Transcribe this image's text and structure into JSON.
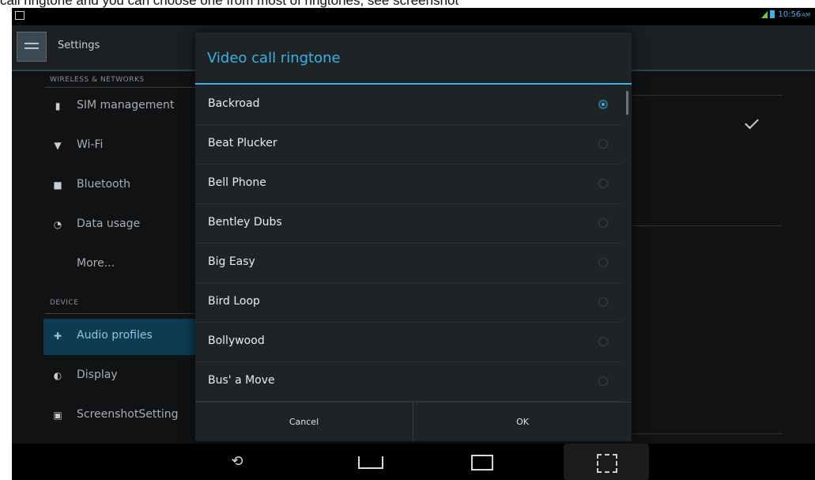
{
  "caption": {
    "text": "call ringtone and you can choose one from most of ringtones, see screenshot"
  },
  "status_bar": {
    "time": "10:56",
    "ampm": "AM"
  },
  "action_bar": {
    "title": "Settings"
  },
  "settings_list": {
    "sections": [
      {
        "header": "WIRELESS & NETWORKS",
        "items": [
          {
            "label": "SIM management",
            "icon": "sim-icon"
          },
          {
            "label": "Wi-Fi",
            "icon": "wifi-icon"
          },
          {
            "label": "Bluetooth",
            "icon": "bluetooth-icon"
          },
          {
            "label": "Data usage",
            "icon": "data-usage-icon"
          },
          {
            "label": "More...",
            "icon": ""
          }
        ]
      },
      {
        "header": "DEVICE",
        "items": [
          {
            "label": "Audio profiles",
            "icon": "audio-profiles-icon",
            "selected": true
          },
          {
            "label": "Display",
            "icon": "display-icon"
          },
          {
            "label": "ScreenshotSetting",
            "icon": "camera-icon"
          }
        ]
      }
    ]
  },
  "dialog": {
    "title": "Video call ringtone",
    "ringtones": [
      {
        "label": "Backroad",
        "checked": true
      },
      {
        "label": "Beat Plucker",
        "checked": false
      },
      {
        "label": "Bell Phone",
        "checked": false
      },
      {
        "label": "Bentley Dubs",
        "checked": false
      },
      {
        "label": "Big Easy",
        "checked": false
      },
      {
        "label": "Bird Loop",
        "checked": false
      },
      {
        "label": "Bollywood",
        "checked": false
      },
      {
        "label": "Bus' a Move",
        "checked": false
      }
    ],
    "cancel_label": "Cancel",
    "ok_label": "OK"
  },
  "nav_bar": {
    "back": "back-icon",
    "home": "home-icon",
    "recent": "recent-apps-icon",
    "screenshot": "screenshot-icon"
  },
  "colors": {
    "accent": "#33b5e5",
    "background": "#111214",
    "dialog": "#202326"
  }
}
